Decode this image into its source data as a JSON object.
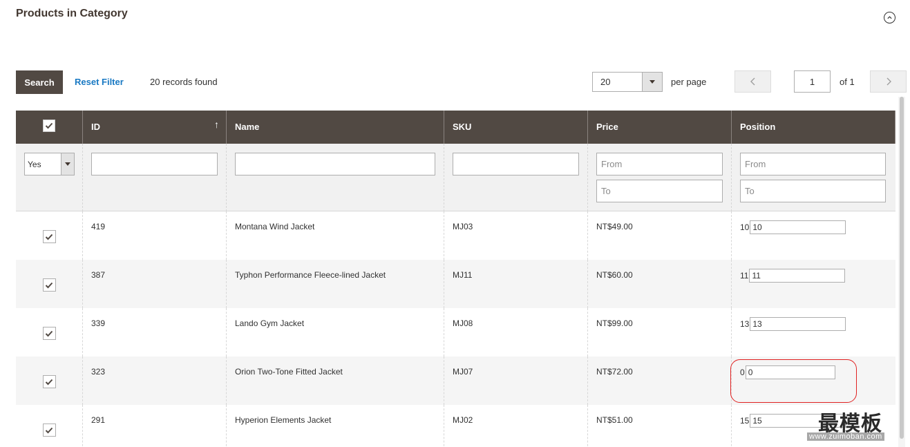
{
  "section": {
    "title": "Products in Category"
  },
  "toolbar": {
    "search_label": "Search",
    "reset_label": "Reset Filter",
    "records_found": "20 records found",
    "per_page_value": "20",
    "per_page_label": "per page",
    "page_value": "1",
    "of_pages": "of 1"
  },
  "columns": {
    "id": "ID",
    "name": "Name",
    "sku": "SKU",
    "price": "Price",
    "position": "Position"
  },
  "filters": {
    "in_category": "Yes",
    "price_from_placeholder": "From",
    "price_to_placeholder": "To",
    "position_from_placeholder": "From",
    "position_to_placeholder": "To"
  },
  "rows": [
    {
      "id": "419",
      "name": "Montana Wind Jacket",
      "sku": "MJ03",
      "price": "NT$49.00",
      "position": "10",
      "position_input": "10"
    },
    {
      "id": "387",
      "name": "Typhon Performance Fleece-lined Jacket",
      "sku": "MJ11",
      "price": "NT$60.00",
      "position": "11",
      "position_input": "11"
    },
    {
      "id": "339",
      "name": "Lando Gym Jacket",
      "sku": "MJ08",
      "price": "NT$99.00",
      "position": "13",
      "position_input": "13"
    },
    {
      "id": "323",
      "name": "Orion Two-Tone Fitted Jacket",
      "sku": "MJ07",
      "price": "NT$72.00",
      "position": "0",
      "position_input": "0"
    },
    {
      "id": "291",
      "name": "Hyperion Elements Jacket",
      "sku": "MJ02",
      "price": "NT$51.00",
      "position": "15",
      "position_input": "15"
    }
  ],
  "watermark": {
    "text": "最模板",
    "url": "www.zuimoban.com"
  },
  "colors": {
    "header_bg": "#514943",
    "link": "#1979c3",
    "highlight": "#e02020"
  }
}
